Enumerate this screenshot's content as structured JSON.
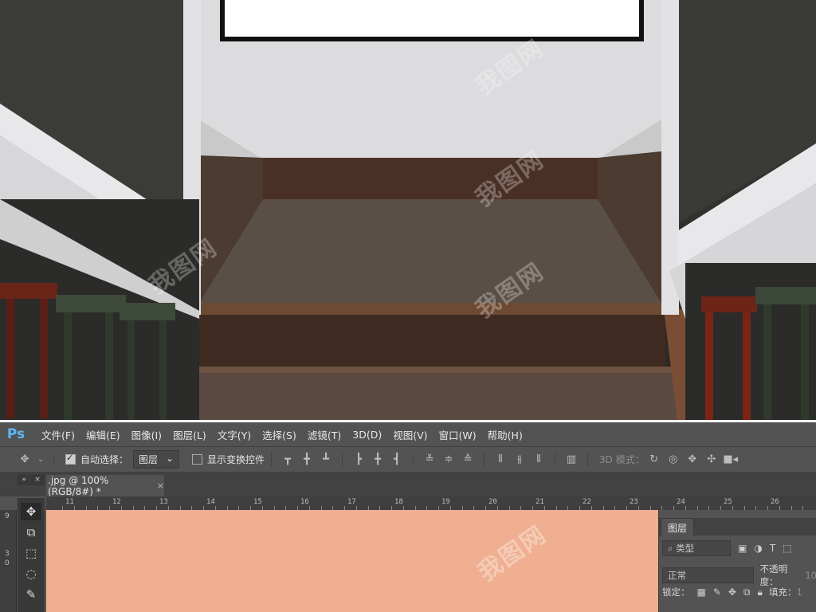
{
  "menubar": {
    "logo": "Ps",
    "items": [
      "文件(F)",
      "编辑(E)",
      "图像(I)",
      "图层(L)",
      "文字(Y)",
      "选择(S)",
      "滤镜(T)",
      "3D(D)",
      "视图(V)",
      "窗口(W)",
      "帮助(H)"
    ]
  },
  "options": {
    "auto_select_label": "自动选择：",
    "auto_select_target": "图层",
    "show_transform_label": "显示变换控件",
    "mode_3d_label": "3D 模式："
  },
  "document": {
    "tab_title": ".jpg @ 100%(RGB/8#) *",
    "tab_close": "×",
    "toolbox_controls": [
      "»",
      "×"
    ]
  },
  "ruler": {
    "top_labels": [
      "11",
      "12",
      "13",
      "14",
      "15",
      "16",
      "17",
      "18",
      "19",
      "20",
      "21",
      "22",
      "23",
      "24",
      "25",
      "26"
    ],
    "left_labels": [
      "9",
      "3",
      "0"
    ]
  },
  "canvas": {
    "fill_color": "#efaf90"
  },
  "layers_panel": {
    "tab_label": "图层",
    "filter_label": "类型",
    "blend_mode": "正常",
    "opacity_label": "不透明度：",
    "opacity_value": "10",
    "lock_label": "锁定：",
    "fill_label": "填充：",
    "fill_value": "1"
  },
  "watermark": "我图网"
}
